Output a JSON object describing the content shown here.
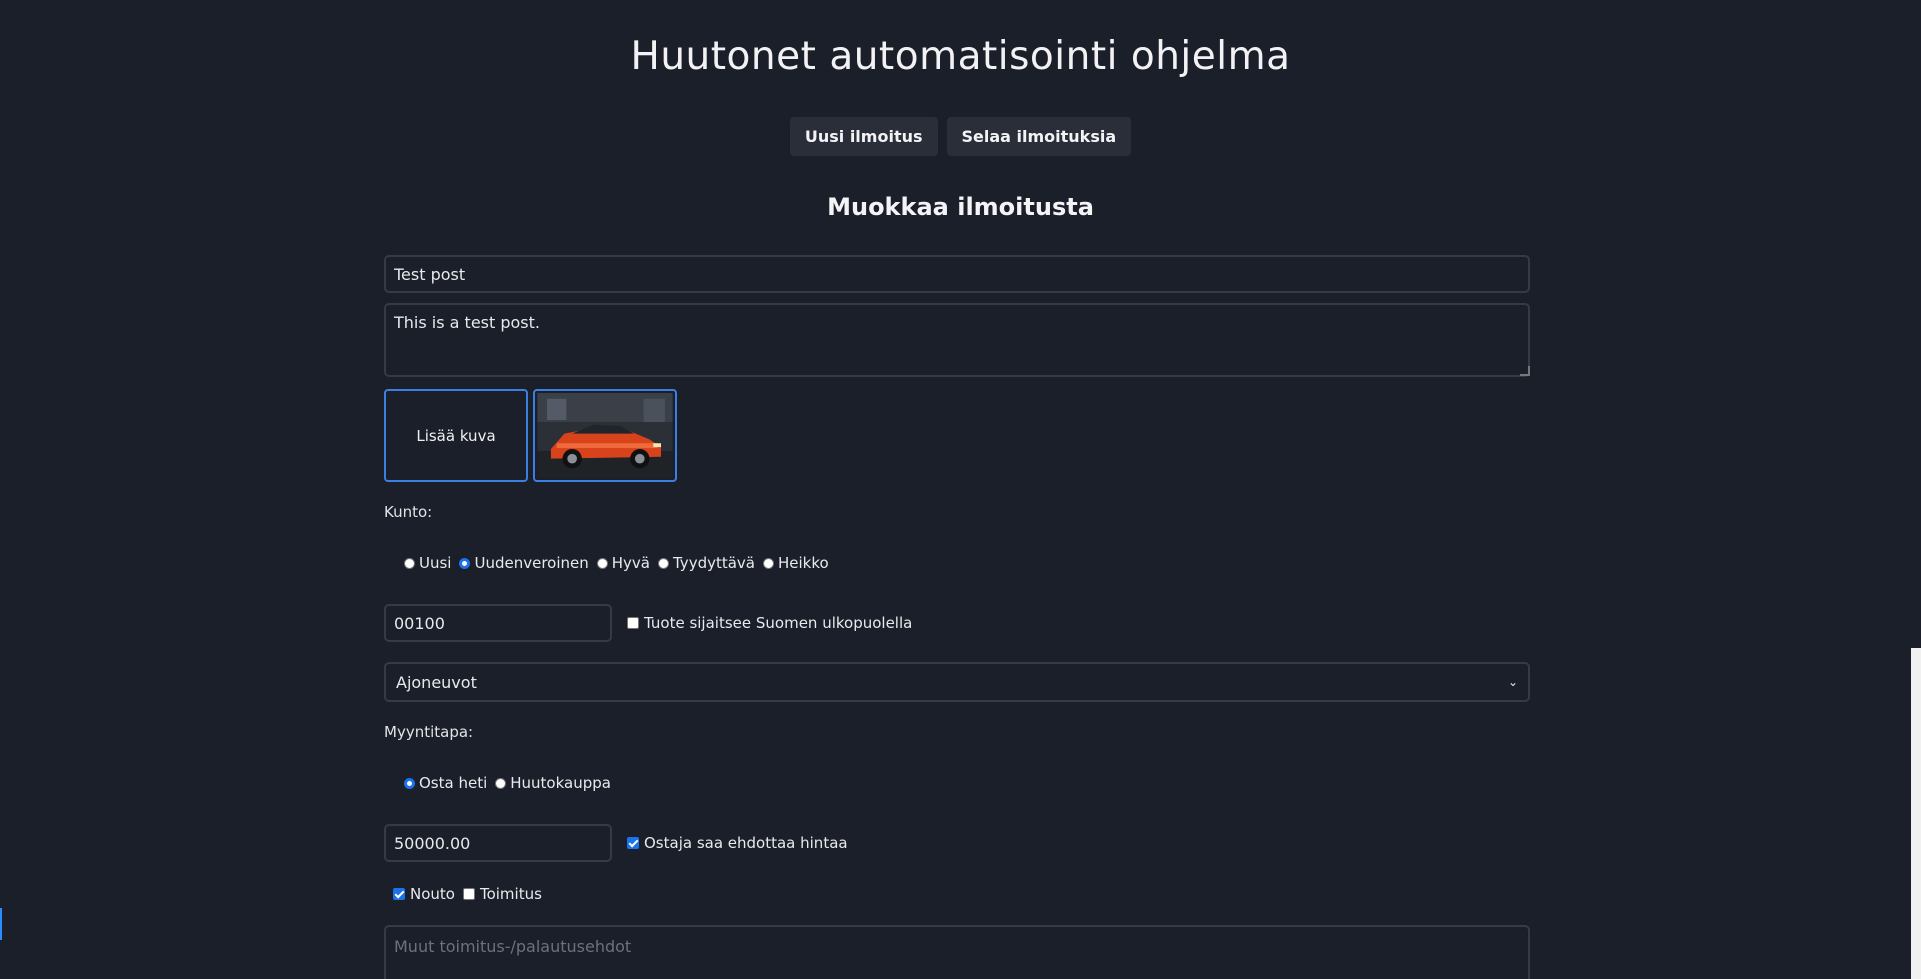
{
  "app": {
    "title": "Huutonet automatisointi ohjelma"
  },
  "nav": {
    "new_label": "Uusi ilmoitus",
    "browse_label": "Selaa ilmoituksia"
  },
  "form": {
    "heading": "Muokkaa ilmoitusta",
    "title_value": "Test post",
    "description_value": "This is a test post.",
    "add_image_label": "Lisää kuva",
    "condition_label": "Kunto:",
    "conditions": [
      "Uusi",
      "Uudenveroinen",
      "Hyvä",
      "Tyydyttävä",
      "Heikko"
    ],
    "condition_selected": "Uudenveroinen",
    "postal_code": "00100",
    "outside_finland_label": "Tuote sijaitsee Suomen ulkopuolella",
    "outside_finland_checked": false,
    "category_value": "Ajoneuvot",
    "sale_type_label": "Myyntitapa:",
    "sale_types": [
      "Osta heti",
      "Huutokauppa"
    ],
    "sale_type_selected": "Osta heti",
    "price_value": "50000.00",
    "buyer_offer_label": "Ostaja saa ehdottaa hintaa",
    "buyer_offer_checked": true,
    "pickup_label": "Nouto",
    "pickup_checked": true,
    "delivery_label": "Toimitus",
    "delivery_checked": false,
    "terms_placeholder": "Muut toimitus-/palautusehdot"
  },
  "colors": {
    "background": "#1b1f2a",
    "accent": "#1a73e8",
    "image_border": "#3d7fe0"
  }
}
